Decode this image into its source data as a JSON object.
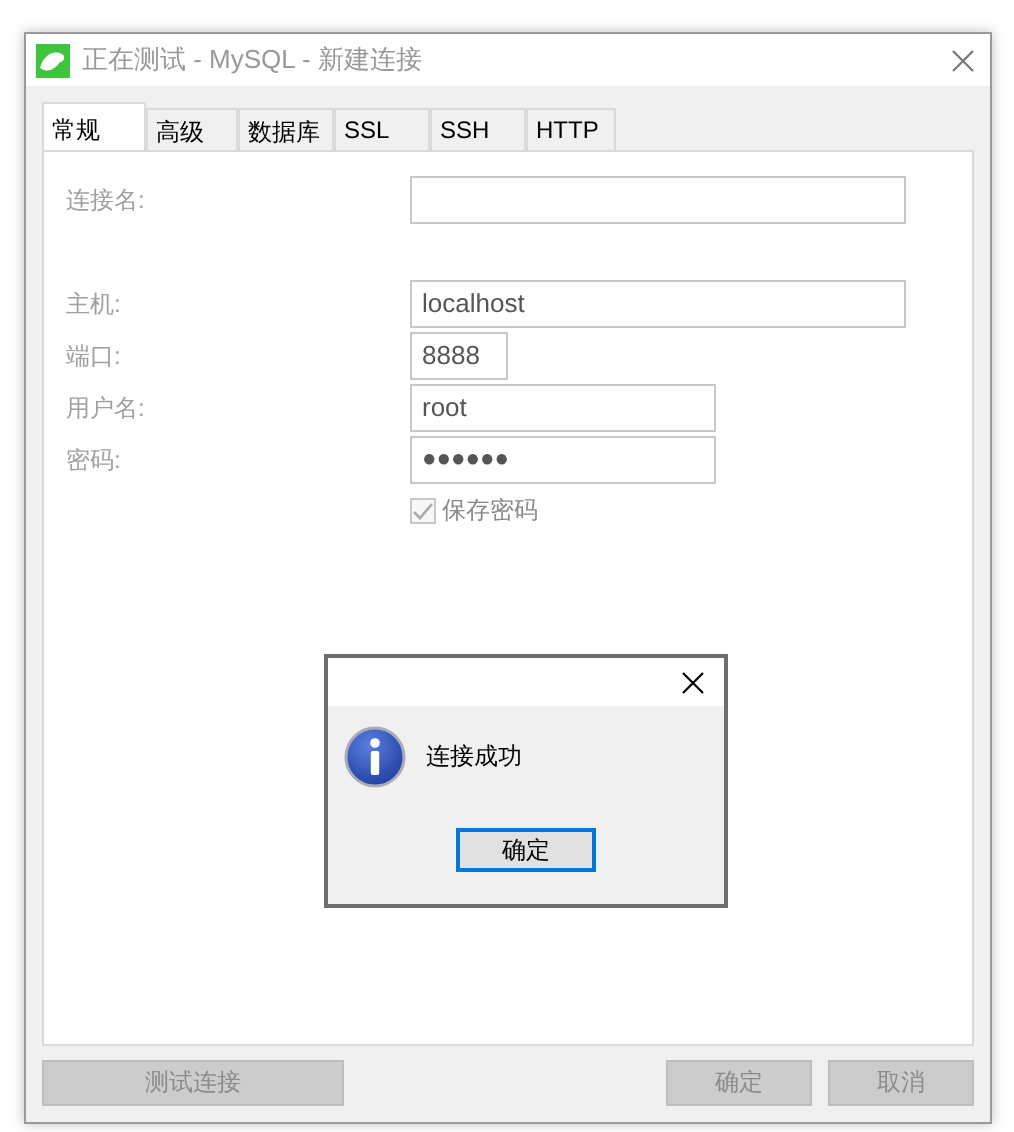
{
  "window": {
    "title": "正在测试 - MySQL - 新建连接"
  },
  "tabs": [
    {
      "label": "常规",
      "selected": true
    },
    {
      "label": "高级",
      "selected": false
    },
    {
      "label": "数据库",
      "selected": false
    },
    {
      "label": "SSL",
      "selected": false
    },
    {
      "label": "SSH",
      "selected": false
    },
    {
      "label": "HTTP",
      "selected": false
    }
  ],
  "form": {
    "disabled": true,
    "fields": [
      {
        "label": "连接名:",
        "kind": "text"
      },
      {
        "label": "主机:",
        "kind": "text",
        "value": "localhost"
      },
      {
        "label": "端口:",
        "kind": "text",
        "value": "8888"
      },
      {
        "label": "用户名:",
        "kind": "text",
        "value": "root"
      },
      {
        "label": "密码:",
        "kind": "password",
        "value": "●●●●●●"
      }
    ],
    "save_password": {
      "label": "保存密码",
      "checked": true,
      "disabled": true
    }
  },
  "buttons": [
    {
      "label": "测试连接",
      "disabled": true
    },
    {
      "label": "确定",
      "disabled": true
    },
    {
      "label": "取消",
      "disabled": true
    }
  ],
  "dialog": {
    "message": "连接成功",
    "button": "确定"
  }
}
